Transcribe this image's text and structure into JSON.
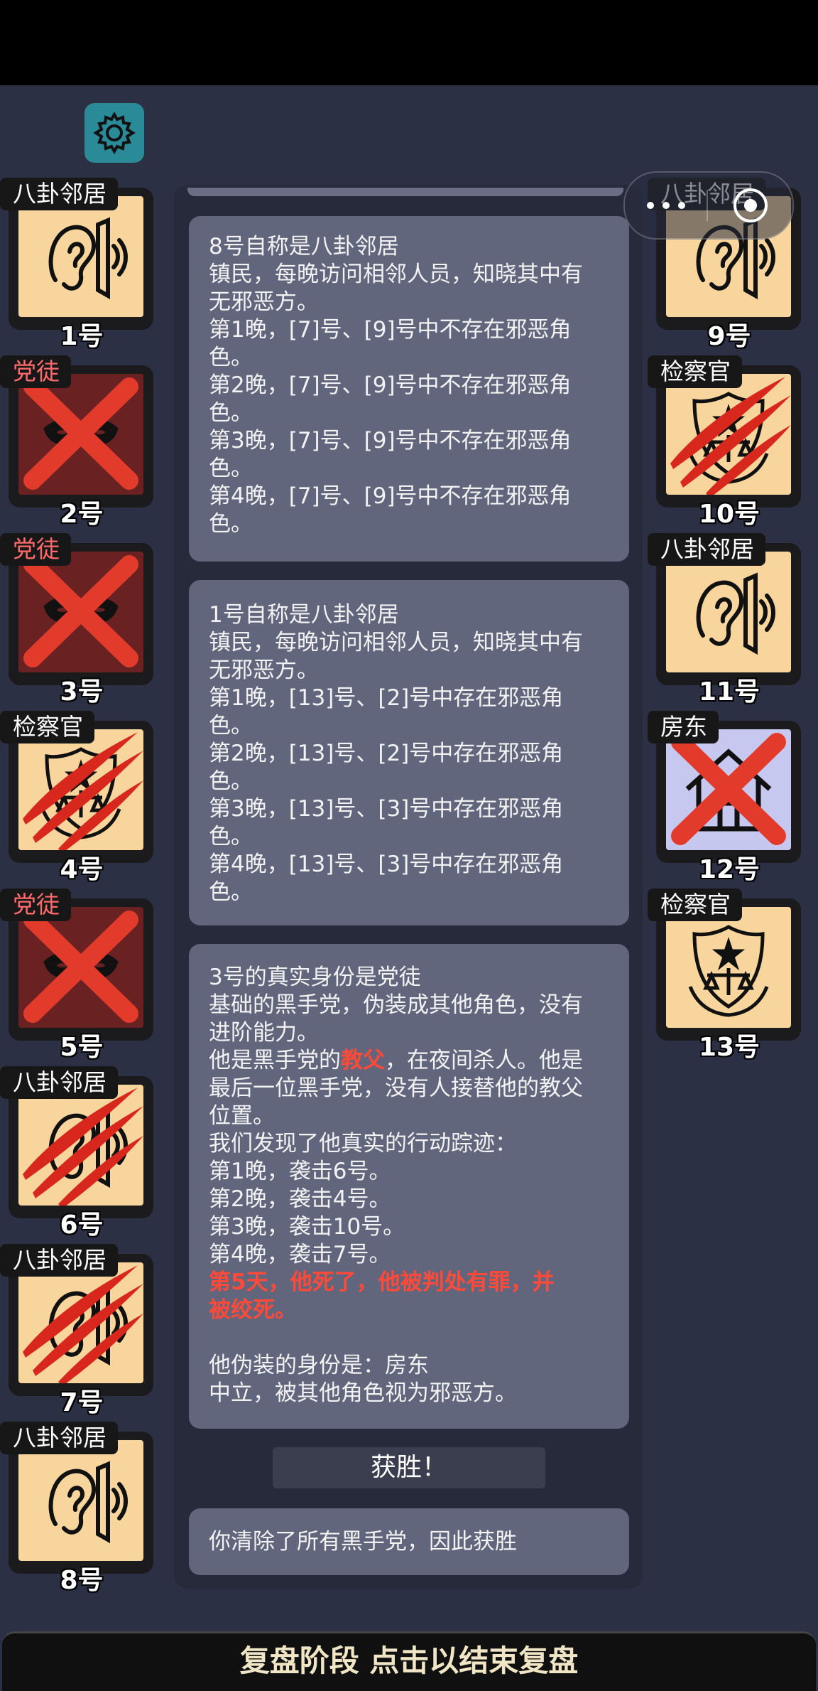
{
  "ui": {
    "settings_icon": "gear-icon",
    "capsule_menu_icon": "more-dots-icon",
    "capsule_close_icon": "target-close-icon"
  },
  "players_left": [
    {
      "role": "八卦邻居",
      "number": "1号",
      "art": "ear",
      "status": "alive"
    },
    {
      "role": "党徒",
      "number": "2号",
      "art": "mask",
      "status": "executed"
    },
    {
      "role": "党徒",
      "number": "3号",
      "art": "mask",
      "status": "executed"
    },
    {
      "role": "检察官",
      "number": "4号",
      "art": "badge",
      "status": "killed"
    },
    {
      "role": "党徒",
      "number": "5号",
      "art": "mask",
      "status": "executed"
    },
    {
      "role": "八卦邻居",
      "number": "6号",
      "art": "ear",
      "status": "killed"
    },
    {
      "role": "八卦邻居",
      "number": "7号",
      "art": "ear",
      "status": "killed"
    },
    {
      "role": "八卦邻居",
      "number": "8号",
      "art": "ear",
      "status": "alive"
    }
  ],
  "players_right": [
    {
      "role": "八卦邻居",
      "number": "9号",
      "art": "ear",
      "status": "alive"
    },
    {
      "role": "检察官",
      "number": "10号",
      "art": "badge",
      "status": "killed"
    },
    {
      "role": "八卦邻居",
      "number": "11号",
      "art": "ear",
      "status": "alive"
    },
    {
      "role": "房东",
      "number": "12号",
      "art": "house",
      "status": "executed"
    },
    {
      "role": "检察官",
      "number": "13号",
      "art": "badge",
      "status": "alive"
    }
  ],
  "messages": {
    "m1": [
      "8号自称是八卦邻居",
      "镇民，每晚访问相邻人员，知晓其中有",
      "无邪恶方。",
      "第1晚，[7]号、[9]号中不存在邪恶角",
      "色。",
      "第2晚，[7]号、[9]号中不存在邪恶角",
      "色。",
      "第3晚，[7]号、[9]号中不存在邪恶角",
      "色。",
      "第4晚，[7]号、[9]号中不存在邪恶角",
      "色。"
    ],
    "m2": [
      "1号自称是八卦邻居",
      "镇民，每晚访问相邻人员，知晓其中有",
      "无邪恶方。",
      "第1晚，[13]号、[2]号中存在邪恶角",
      "色。",
      "第2晚，[13]号、[2]号中存在邪恶角",
      "色。",
      "第3晚，[13]号、[3]号中存在邪恶角",
      "色。",
      "第4晚，[13]号、[3]号中存在邪恶角",
      "色。"
    ],
    "m3": {
      "title": "3号的真实身份是党徒",
      "desc1": "基础的黑手党，伪装成其他角色，没有",
      "desc2": "进阶能力。",
      "godfather_pre": "他是黑手党的",
      "godfather_word": "教父",
      "godfather_post": "，在夜间杀人。他是",
      "last1": "最后一位黑手党，没有人接替他的教父",
      "last2": "位置。",
      "trace": "我们发现了他真实的行动踪迹：",
      "n1": "第1晚，袭击6号。",
      "n2": "第2晚，袭击4号。",
      "n3": "第3晚，袭击10号。",
      "n4": "第4晚，袭击7号。",
      "death1": "第5天，他死了，他被判处有罪，并",
      "death2": "被绞死。",
      "disguise": "他伪装的身份是：房东",
      "disguise_desc": "中立，被其他角色视为邪恶方。"
    },
    "victory": "获胜！",
    "result": "你清除了所有黑手党，因此获胜"
  },
  "bottom_bar": "复盘阶段 点击以结束复盘",
  "colors": {
    "background": "#2c3045",
    "card_neutral": "#f7d59c",
    "card_evil": "#6a2122",
    "card_landlord": "#c7c8f0",
    "mark_red": "#e23b2c",
    "highlight_red": "#ff4a3a"
  }
}
